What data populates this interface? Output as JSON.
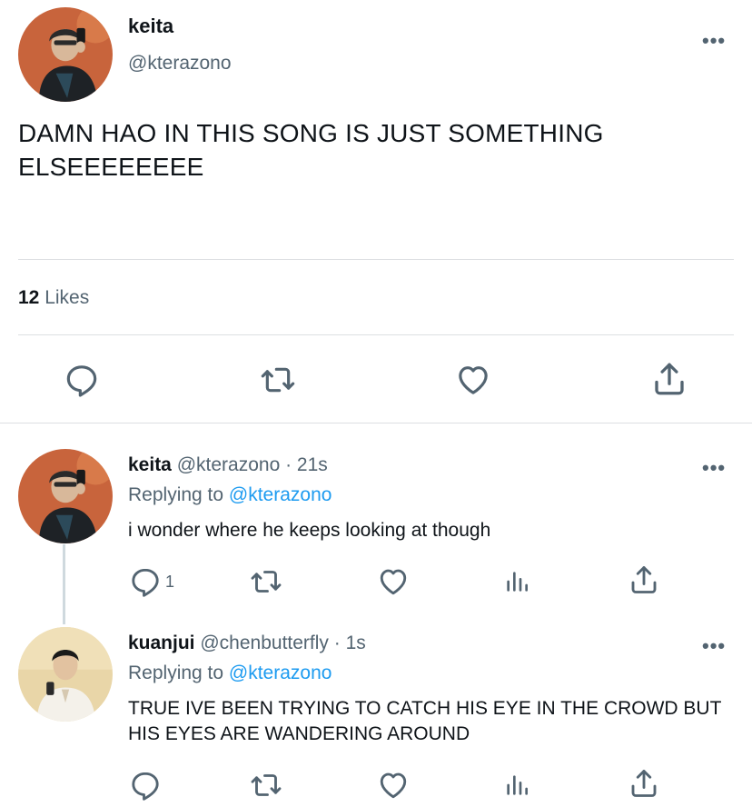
{
  "main_tweet": {
    "name": "keita",
    "handle": "@kterazono",
    "text": "DAMN HAO IN THIS SONG IS JUST SOMETHING ELSEEEEEEEE",
    "likes_count": "12",
    "likes_label": "Likes",
    "more_label": "•••",
    "avatar_icon": "avatar-keita"
  },
  "replies": [
    {
      "name": "keita",
      "handle": "@kterazono",
      "time": "· 21s",
      "replying_prefix": "Replying to",
      "replying_to": "@kterazono",
      "text": "i wonder where he keeps looking at though",
      "reply_count": "1",
      "more_label": "•••",
      "avatar_icon": "avatar-keita"
    },
    {
      "name": "kuanjui",
      "handle": "@chenbutterfly",
      "time": "· 1s",
      "replying_prefix": "Replying to",
      "replying_to": "@kterazono",
      "text": "TRUE IVE BEEN TRYING TO CATCH HIS EYE IN THE CROWD BUT HIS EYES ARE WANDERING AROUND",
      "reply_count": "",
      "more_label": "•••",
      "avatar_icon": "avatar-kuanjui"
    }
  ],
  "icons": {
    "reply": "reply-icon",
    "retweet": "retweet-icon",
    "like": "heart-icon",
    "analytics": "analytics-icon",
    "share": "share-icon"
  },
  "colors": {
    "text": "#0f1419",
    "secondary": "#536471",
    "link": "#1d9bf0",
    "divider": "#dcdfe2"
  }
}
